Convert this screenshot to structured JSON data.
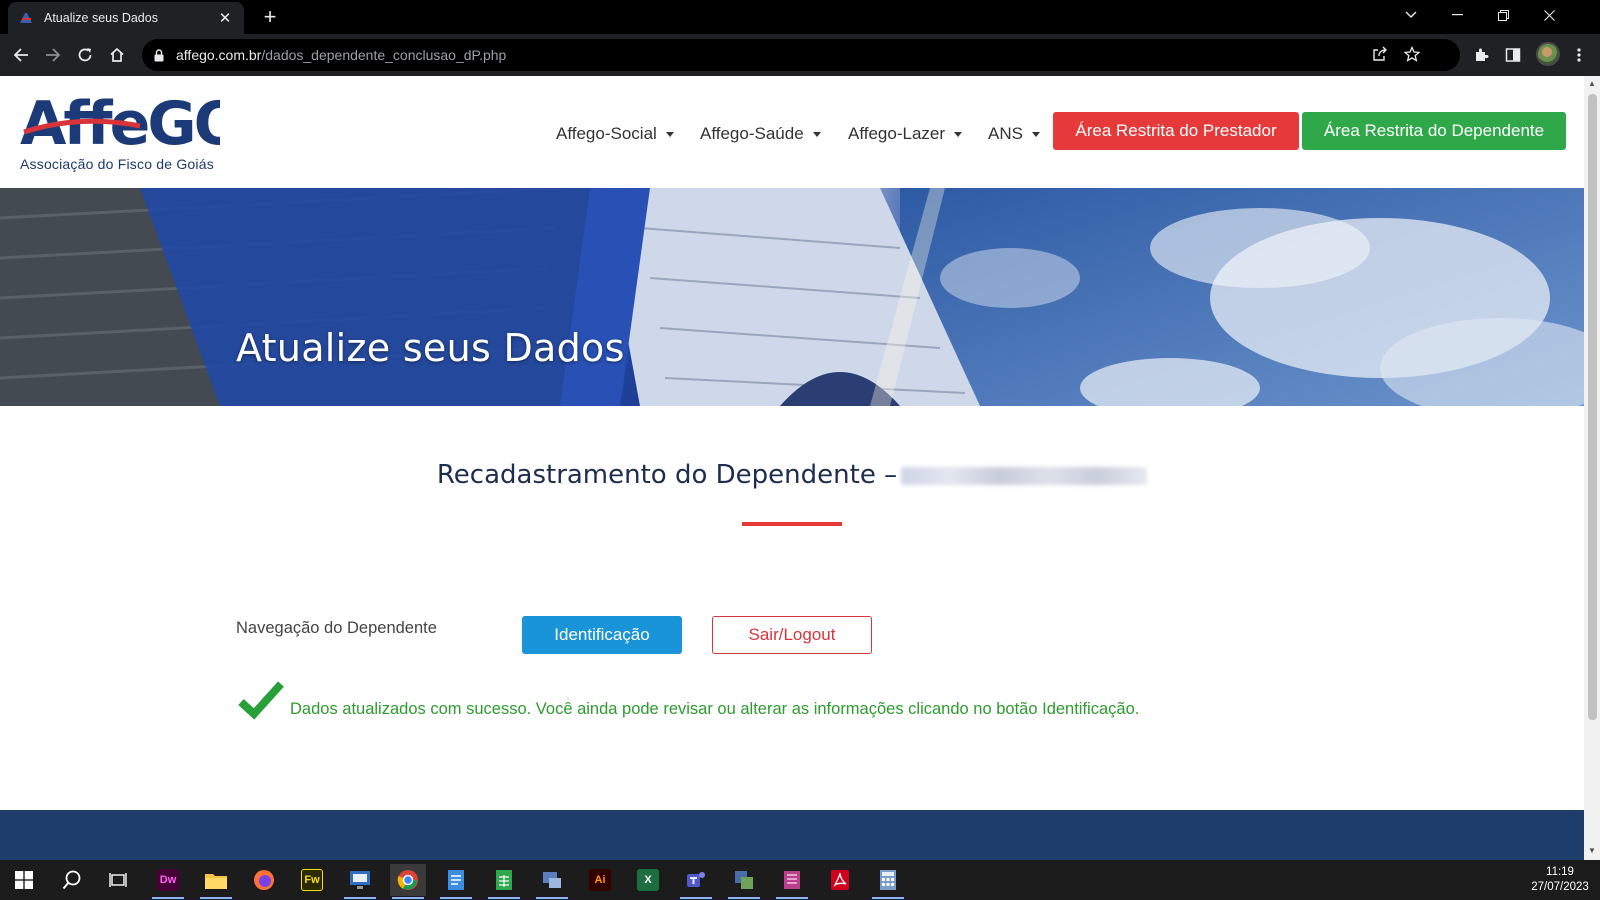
{
  "browser": {
    "tab_title": "Atualize seus Dados",
    "url_host": "affego.com.br",
    "url_path": "/dados_dependente_conclusao_dP.php"
  },
  "site": {
    "logo_text": "AffeGO",
    "logo_subtitle": "Associação do Fisco de Goiás",
    "menu": [
      {
        "label": "Affego-Social"
      },
      {
        "label": "Affego-Saúde"
      },
      {
        "label": "Affego-Lazer"
      },
      {
        "label": "ANS"
      }
    ],
    "btn_prestador": "Área Restrita do Prestador",
    "btn_dependente": "Área Restrita do Dependente",
    "brand_colors": {
      "red": "#e63a3a",
      "green": "#2fa84a",
      "blue": "#1a94d8",
      "navy": "#1f3d6b"
    }
  },
  "banner": {
    "title": "Atualize seus Dados"
  },
  "content": {
    "section_title": "Recadastramento do Dependente –",
    "nav_label": "Navegação do Dependente",
    "btn_identificacao": "Identificação",
    "btn_logout": "Sair/Logout",
    "success_message": "Dados atualizados com sucesso. Você ainda pode revisar ou alterar as informações clicando no botão Identificação."
  },
  "taskbar": {
    "time": "11:19",
    "date": "27/07/2023",
    "apps": [
      {
        "name": "dreamweaver-icon",
        "glyph": "Dw"
      },
      {
        "name": "fireworks-icon",
        "glyph": "Fw"
      },
      {
        "name": "illustrator-icon",
        "glyph": "Ai"
      },
      {
        "name": "excel-icon",
        "glyph": "X"
      }
    ]
  }
}
